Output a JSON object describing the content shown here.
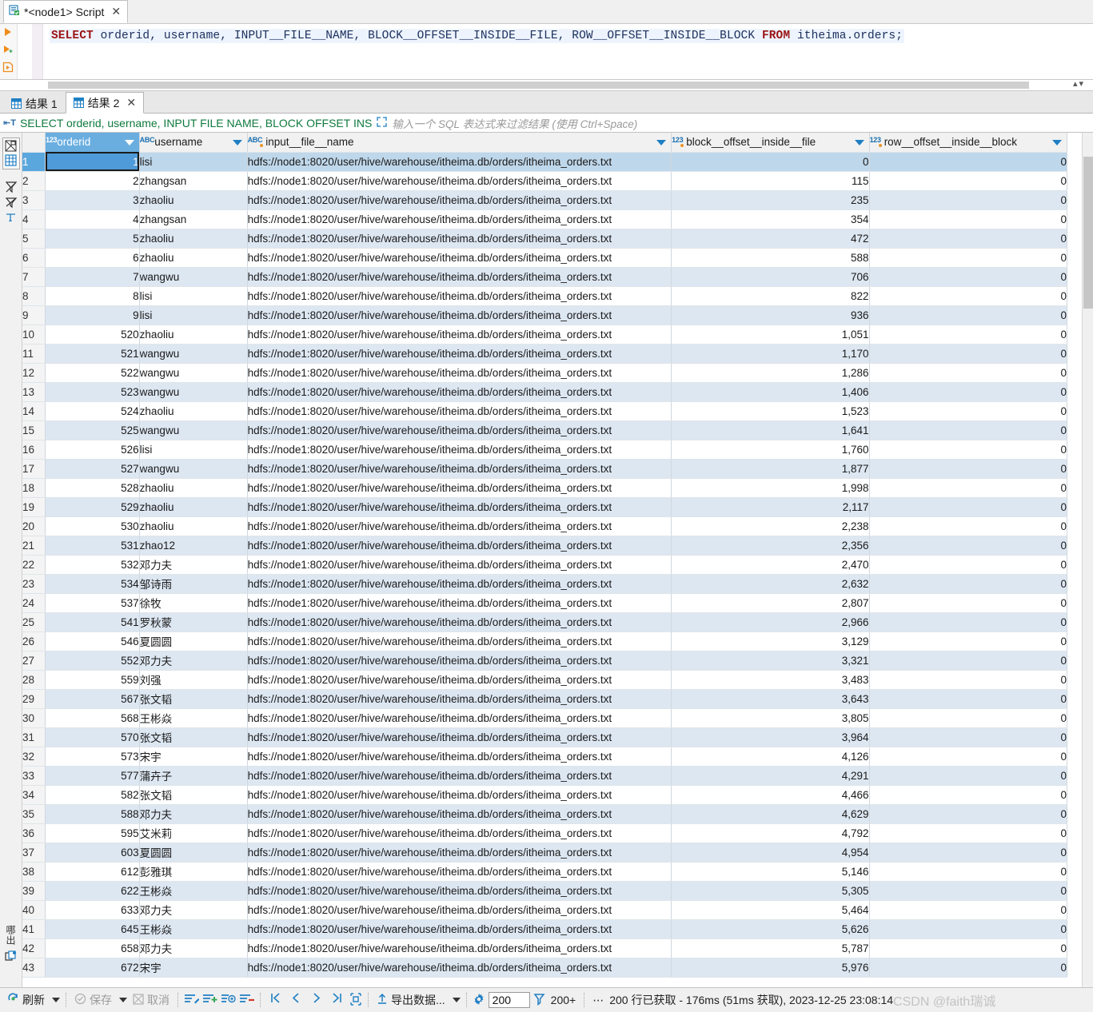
{
  "editor": {
    "tab": {
      "title": "*<node1> Script",
      "icon": "script-file-icon",
      "close": "✕"
    },
    "sql_parts": {
      "kw1": "SELECT",
      "mid": " orderid, username, INPUT__FILE__NAME, BLOCK__OFFSET__INSIDE__FILE, ROW__OFFSET__INSIDE__BLOCK ",
      "kw2": "FROM",
      "tail": " itheima.orders;"
    },
    "sql_full": "SELECT orderid, username, INPUT__FILE__NAME, BLOCK__OFFSET__INSIDE__FILE, ROW__OFFSET__INSIDE__BLOCK FROM itheima.orders;",
    "gutter_icons": [
      "run-statement-icon",
      "run-script-icon",
      "execute-sql-icon"
    ]
  },
  "result_tabs": [
    {
      "label": "结果 1",
      "icon": "grid-icon",
      "active": false,
      "closable": false
    },
    {
      "label": "结果 2",
      "icon": "grid-icon",
      "active": true,
      "closable": true,
      "close": "✕"
    }
  ],
  "filter_bar": {
    "icon": "sql-text-icon",
    "query_text": "SELECT orderid, username, INPUT  FILE  NAME, BLOCK  OFFSET  INS",
    "expand_icon": "expand-arrows-icon",
    "placeholder": "输入一个 SQL 表达式来过滤结果 (使用 Ctrl+Space)"
  },
  "side_toolbar": {
    "icons": [
      "grid-presentation-icon",
      "grid-view-icon",
      "filter-off-icon",
      "no-filter-icon",
      "row-order-icon"
    ],
    "label": "哪出",
    "bottom_icon": "copy-icon"
  },
  "grid": {
    "columns": [
      {
        "name": "orderid",
        "type": "123",
        "selected": true,
        "pk": false,
        "align": "right"
      },
      {
        "name": "username",
        "type": "ABC",
        "selected": false,
        "pk": false,
        "align": "left"
      },
      {
        "name": "input__file__name",
        "type": "ABC",
        "selected": false,
        "pk": true,
        "align": "left"
      },
      {
        "name": "block__offset__inside__file",
        "type": "123",
        "selected": false,
        "pk": true,
        "align": "right"
      },
      {
        "name": "row__offset__inside__block",
        "type": "123",
        "selected": false,
        "pk": true,
        "align": "right"
      }
    ],
    "path_value": "hdfs://node1:8020/user/hive/warehouse/itheima.db/orders/itheima_orders.txt",
    "rows": [
      {
        "n": "1",
        "orderid": "1",
        "username": "lisi",
        "block": "0",
        "row": "0"
      },
      {
        "n": "2",
        "orderid": "2",
        "username": "zhangsan",
        "block": "115",
        "row": "0"
      },
      {
        "n": "3",
        "orderid": "3",
        "username": "zhaoliu",
        "block": "235",
        "row": "0"
      },
      {
        "n": "4",
        "orderid": "4",
        "username": "zhangsan",
        "block": "354",
        "row": "0"
      },
      {
        "n": "5",
        "orderid": "5",
        "username": "zhaoliu",
        "block": "472",
        "row": "0"
      },
      {
        "n": "6",
        "orderid": "6",
        "username": "zhaoliu",
        "block": "588",
        "row": "0"
      },
      {
        "n": "7",
        "orderid": "7",
        "username": "wangwu",
        "block": "706",
        "row": "0"
      },
      {
        "n": "8",
        "orderid": "8",
        "username": "lisi",
        "block": "822",
        "row": "0"
      },
      {
        "n": "9",
        "orderid": "9",
        "username": "lisi",
        "block": "936",
        "row": "0"
      },
      {
        "n": "10",
        "orderid": "520",
        "username": "zhaoliu",
        "block": "1,051",
        "row": "0"
      },
      {
        "n": "11",
        "orderid": "521",
        "username": "wangwu",
        "block": "1,170",
        "row": "0"
      },
      {
        "n": "12",
        "orderid": "522",
        "username": "wangwu",
        "block": "1,286",
        "row": "0"
      },
      {
        "n": "13",
        "orderid": "523",
        "username": "wangwu",
        "block": "1,406",
        "row": "0"
      },
      {
        "n": "14",
        "orderid": "524",
        "username": "zhaoliu",
        "block": "1,523",
        "row": "0"
      },
      {
        "n": "15",
        "orderid": "525",
        "username": "wangwu",
        "block": "1,641",
        "row": "0"
      },
      {
        "n": "16",
        "orderid": "526",
        "username": "lisi",
        "block": "1,760",
        "row": "0"
      },
      {
        "n": "17",
        "orderid": "527",
        "username": "wangwu",
        "block": "1,877",
        "row": "0"
      },
      {
        "n": "18",
        "orderid": "528",
        "username": "zhaoliu",
        "block": "1,998",
        "row": "0"
      },
      {
        "n": "19",
        "orderid": "529",
        "username": "zhaoliu",
        "block": "2,117",
        "row": "0"
      },
      {
        "n": "20",
        "orderid": "530",
        "username": "zhaoliu",
        "block": "2,238",
        "row": "0"
      },
      {
        "n": "21",
        "orderid": "531",
        "username": "zhao12",
        "block": "2,356",
        "row": "0"
      },
      {
        "n": "22",
        "orderid": "532",
        "username": "邓力夫",
        "block": "2,470",
        "row": "0"
      },
      {
        "n": "23",
        "orderid": "534",
        "username": "邹诗雨",
        "block": "2,632",
        "row": "0"
      },
      {
        "n": "24",
        "orderid": "537",
        "username": "徐牧",
        "block": "2,807",
        "row": "0"
      },
      {
        "n": "25",
        "orderid": "541",
        "username": "罗秋蒙",
        "block": "2,966",
        "row": "0"
      },
      {
        "n": "26",
        "orderid": "546",
        "username": "夏圆圆",
        "block": "3,129",
        "row": "0"
      },
      {
        "n": "27",
        "orderid": "552",
        "username": "邓力夫",
        "block": "3,321",
        "row": "0"
      },
      {
        "n": "28",
        "orderid": "559",
        "username": "刘强",
        "block": "3,483",
        "row": "0"
      },
      {
        "n": "29",
        "orderid": "567",
        "username": "张文韬",
        "block": "3,643",
        "row": "0"
      },
      {
        "n": "30",
        "orderid": "568",
        "username": "王彬焱",
        "block": "3,805",
        "row": "0"
      },
      {
        "n": "31",
        "orderid": "570",
        "username": "张文韬",
        "block": "3,964",
        "row": "0"
      },
      {
        "n": "32",
        "orderid": "573",
        "username": "宋宇",
        "block": "4,126",
        "row": "0"
      },
      {
        "n": "33",
        "orderid": "577",
        "username": "蒲卉子",
        "block": "4,291",
        "row": "0"
      },
      {
        "n": "34",
        "orderid": "582",
        "username": "张文韬",
        "block": "4,466",
        "row": "0"
      },
      {
        "n": "35",
        "orderid": "588",
        "username": "邓力夫",
        "block": "4,629",
        "row": "0"
      },
      {
        "n": "36",
        "orderid": "595",
        "username": "艾米莉",
        "block": "4,792",
        "row": "0"
      },
      {
        "n": "37",
        "orderid": "603",
        "username": "夏圆圆",
        "block": "4,954",
        "row": "0"
      },
      {
        "n": "38",
        "orderid": "612",
        "username": "彭雅琪",
        "block": "5,146",
        "row": "0"
      },
      {
        "n": "39",
        "orderid": "622",
        "username": "王彬焱",
        "block": "5,305",
        "row": "0"
      },
      {
        "n": "40",
        "orderid": "633",
        "username": "邓力夫",
        "block": "5,464",
        "row": "0"
      },
      {
        "n": "41",
        "orderid": "645",
        "username": "王彬焱",
        "block": "5,626",
        "row": "0"
      },
      {
        "n": "42",
        "orderid": "658",
        "username": "邓力夫",
        "block": "5,787",
        "row": "0"
      },
      {
        "n": "43",
        "orderid": "672",
        "username": "宋宇",
        "block": "5,976",
        "row": "0"
      }
    ]
  },
  "status_bar": {
    "refresh_label": "刷新",
    "save_label": "保存",
    "cancel_label": "取消",
    "export_label": "导出数据...",
    "fetch_size": "200",
    "fetch_more_label": "200+",
    "ellipsis": "⋯",
    "status_text": "200 行已获取 - 176ms (51ms 获取), 2023-12-25 23:08:14",
    "watermark": "CSDN @faith瑞诚",
    "nav_first": "⏮",
    "nav_prev": "‹",
    "nav_next": "›",
    "nav_last": "⏭"
  },
  "colors": {
    "accent": "#1f7fc4",
    "selection": "#4f9ad8",
    "alt_row": "#dde7f2",
    "keyword": "#9b1313",
    "filter_green": "#0f7a3d"
  }
}
